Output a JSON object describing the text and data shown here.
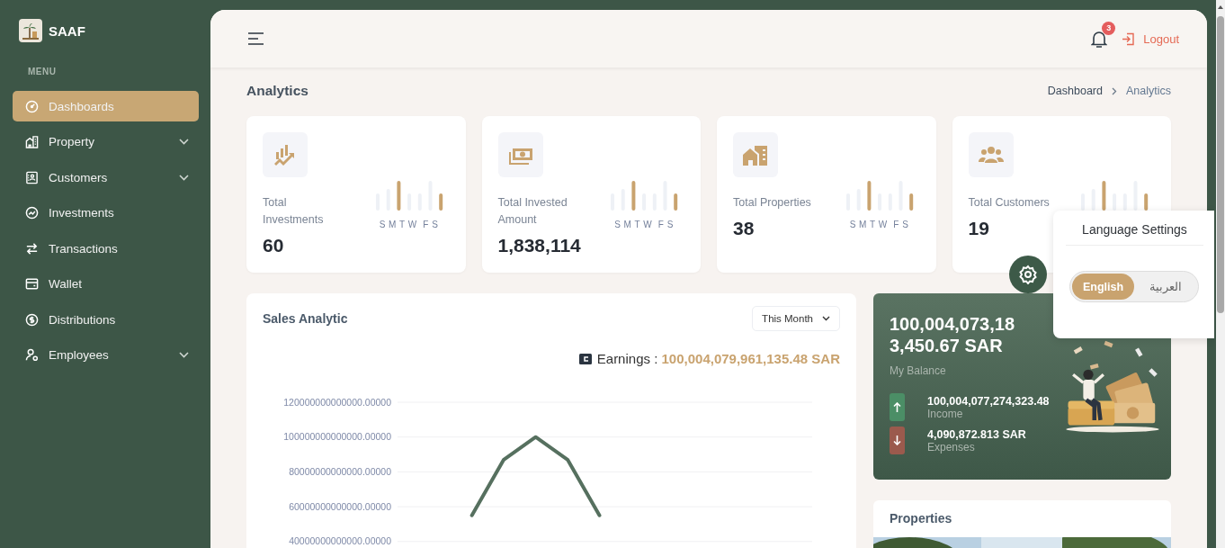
{
  "sidebar": {
    "brand": "SAAF",
    "section_label": "MENU",
    "items": [
      {
        "label": "Dashboards",
        "selected": true,
        "expandable": false
      },
      {
        "label": "Property",
        "selected": false,
        "expandable": true
      },
      {
        "label": "Customers",
        "selected": false,
        "expandable": true
      },
      {
        "label": "Investments",
        "selected": false,
        "expandable": false
      },
      {
        "label": "Transactions",
        "selected": false,
        "expandable": false
      },
      {
        "label": "Wallet",
        "selected": false,
        "expandable": false
      },
      {
        "label": "Distributions",
        "selected": false,
        "expandable": false
      },
      {
        "label": "Employees",
        "selected": false,
        "expandable": true
      }
    ]
  },
  "header": {
    "notification_count": "3",
    "logout_label": "Logout"
  },
  "page": {
    "title": "Analytics",
    "breadcrumb": [
      "Dashboard",
      "Analytics"
    ]
  },
  "stats": [
    {
      "label": "Total Investments",
      "value": "60",
      "days": "S M T W  F S"
    },
    {
      "label": "Total Invested Amount",
      "value": "1,838,114",
      "days": "S M T W  F S"
    },
    {
      "label": "Total Properties",
      "value": "38",
      "days": "S M T W  F S"
    },
    {
      "label": "Total Customers",
      "value": "19"
    }
  ],
  "sales": {
    "title": "Sales Analytic",
    "period": "This Month",
    "earnings_label": "Earnings :",
    "earnings_value": "100,004,079,961,135.48 SAR",
    "chart_data": {
      "type": "line",
      "yticks": [
        {
          "value": 120000000000000,
          "label": "120000000000000.00000"
        },
        {
          "value": 100000000000000,
          "label": "100000000000000.00000"
        },
        {
          "value": 80000000000000,
          "label": "80000000000000.00000"
        },
        {
          "value": 60000000000000,
          "label": "60000000000000.00000"
        },
        {
          "value": 40000000000000,
          "label": "40000000000000.00000"
        }
      ],
      "ylim": [
        40000000000000,
        120000000000000
      ],
      "grid": true,
      "categories": [
        null,
        null,
        null,
        null,
        null,
        null,
        null,
        null,
        null,
        null,
        null,
        null,
        null
      ],
      "values": [
        null,
        null,
        55000000000000,
        87000000000000,
        100000000000000,
        87000000000000,
        55000000000000,
        null,
        null,
        null,
        null,
        null,
        null
      ]
    }
  },
  "balance": {
    "amount": "100,004,073,183,450.67 SAR",
    "label": "My Balance",
    "entries": [
      {
        "kind": "income",
        "amount": "100,004,077,274,323.48",
        "label": "Income"
      },
      {
        "kind": "expense",
        "amount": "4,090,872.813 SAR",
        "label": "Expenses"
      }
    ]
  },
  "properties": {
    "title": "Properties"
  },
  "language_settings": {
    "title": "Language Settings",
    "options": [
      {
        "label": "English",
        "selected": true
      },
      {
        "label": "العربية",
        "selected": false
      }
    ]
  }
}
